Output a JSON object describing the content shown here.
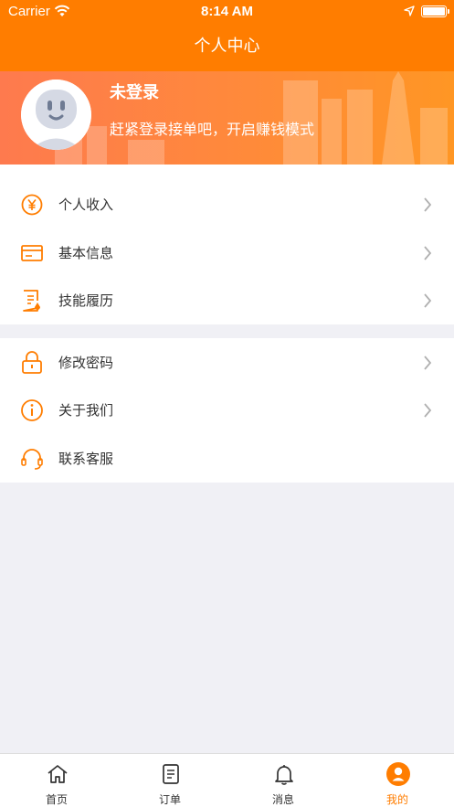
{
  "status_bar": {
    "carrier": "Carrier",
    "time": "8:14 AM"
  },
  "nav": {
    "title": "个人中心"
  },
  "profile": {
    "name": "未登录",
    "hint": "赶紧登录接单吧，开启赚钱模式"
  },
  "menu_section_1": [
    {
      "label": "个人收入",
      "icon": "yen-coin-icon"
    },
    {
      "label": "基本信息",
      "icon": "card-icon"
    },
    {
      "label": "技能履历",
      "icon": "document-icon"
    }
  ],
  "menu_section_2": [
    {
      "label": "修改密码",
      "icon": "lock-icon"
    },
    {
      "label": "关于我们",
      "icon": "info-icon"
    },
    {
      "label": "联系客服",
      "icon": "headset-icon"
    }
  ],
  "tabs": [
    {
      "label": "首页",
      "icon": "home-icon"
    },
    {
      "label": "订单",
      "icon": "order-list-icon"
    },
    {
      "label": "消息",
      "icon": "bell-icon"
    },
    {
      "label": "我的",
      "icon": "user-icon",
      "active": true
    }
  ],
  "colors": {
    "accent": "#ff7d00",
    "background": "#f0f0f5",
    "text": "#333333",
    "chevron": "#b0b0b0"
  }
}
